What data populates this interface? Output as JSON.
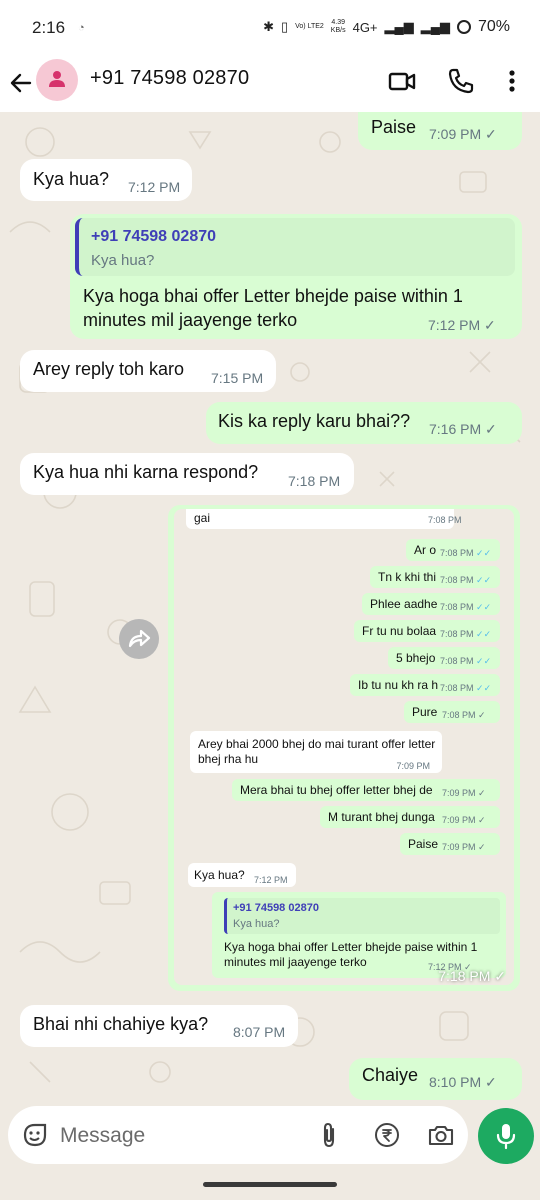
{
  "status_bar": {
    "time": "2:16",
    "network_speed_value": "4.39",
    "network_speed_unit": "KB/s",
    "volte": "Vo) LTE2",
    "network_type": "4G+",
    "battery": "70%"
  },
  "header": {
    "contact_name": "+91 74598 02870"
  },
  "messages": [
    {
      "dir": "out",
      "text": "Paise",
      "time": "7:09 PM",
      "status": "✓"
    },
    {
      "dir": "in",
      "text": "Kya hua?",
      "time": "7:12 PM"
    },
    {
      "dir": "out",
      "quote_name": "+91 74598 02870",
      "quote_text": "Kya hua?",
      "text_line1": "Kya hoga bhai offer Letter bhejde paise within 1",
      "text_line2": "minutes mil jaayenge terko",
      "time": "7:12 PM",
      "status": "✓"
    },
    {
      "dir": "in",
      "text": "Arey reply toh karo",
      "time": "7:15 PM"
    },
    {
      "dir": "out",
      "text": "Kis ka reply karu bhai??",
      "time": "7:16 PM",
      "status": "✓"
    },
    {
      "dir": "in",
      "text": "Kya hua nhi karna respond?",
      "time": "7:18 PM"
    },
    {
      "dir": "out",
      "type": "image",
      "time": "7:18 PM",
      "status": "✓"
    },
    {
      "dir": "in",
      "text": "Bhai nhi chahiye kya?",
      "time": "8:07 PM"
    },
    {
      "dir": "out",
      "text": "Chaiye",
      "time": "8:10 PM",
      "status": "✓"
    }
  ],
  "screenshot_chat": {
    "top_fragment": "gai",
    "top_fragment_time": "7:08 PM",
    "items": [
      {
        "dir": "out",
        "text": "Ar o",
        "time": "7:08 PM",
        "status": "✓✓"
      },
      {
        "dir": "out",
        "text": "Tn k khi thi",
        "time": "7:08 PM",
        "status": "✓✓"
      },
      {
        "dir": "out",
        "text": "Phlee aadhe",
        "time": "7:08 PM",
        "status": "✓✓"
      },
      {
        "dir": "out",
        "text": "Fr tu nu bolaa",
        "time": "7:08 PM",
        "status": "✓✓"
      },
      {
        "dir": "out",
        "text": "5 bhejo",
        "time": "7:08 PM",
        "status": "✓✓"
      },
      {
        "dir": "out",
        "text": "Ib tu nu kh ra h",
        "time": "7:08 PM",
        "status": "✓✓"
      },
      {
        "dir": "out",
        "text": "Pure",
        "time": "7:08 PM",
        "status": "✓"
      },
      {
        "dir": "in",
        "text_line1": "Arey bhai 2000 bhej do mai turant offer letter",
        "text_line2": "bhej rha hu",
        "time": "7:09 PM"
      },
      {
        "dir": "out",
        "text": "Mera bhai tu bhej offer letter bhej de",
        "time": "7:09 PM",
        "status": "✓"
      },
      {
        "dir": "out",
        "text": "M turant bhej dunga",
        "time": "7:09 PM",
        "status": "✓"
      },
      {
        "dir": "out",
        "text": "Paise",
        "time": "7:09 PM",
        "status": "✓"
      },
      {
        "dir": "in",
        "text": "Kya hua?",
        "time": "7:12 PM"
      },
      {
        "dir": "out",
        "quote_name": "+91 74598 02870",
        "quote_text": "Kya hua?",
        "text_line1": "Kya hoga bhai offer Letter bhejde paise within 1",
        "text_line2": "minutes mil jaayenge terko",
        "time": "7:12 PM",
        "status": "✓"
      }
    ]
  },
  "composer": {
    "placeholder": "Message"
  },
  "icons": {
    "back": "arrow-left-icon",
    "avatar": "person-icon",
    "video": "video-call-icon",
    "call": "phone-icon",
    "menu": "more-vert-icon",
    "sticker": "sticker-icon",
    "attach": "paperclip-icon",
    "payment": "rupee-icon",
    "camera": "camera-icon",
    "mic": "mic-icon",
    "forward": "forward-icon"
  },
  "colors": {
    "header_bg": "#ffffff",
    "chat_bg": "#efeae2",
    "outgoing_bubble": "#d9fdd3",
    "incoming_bubble": "#ffffff",
    "accent_green": "#1daa61",
    "quote_bar": "#3f3fb7",
    "avatar_bg": "#f6c8d4",
    "read_tick_blue": "#53bdeb"
  }
}
